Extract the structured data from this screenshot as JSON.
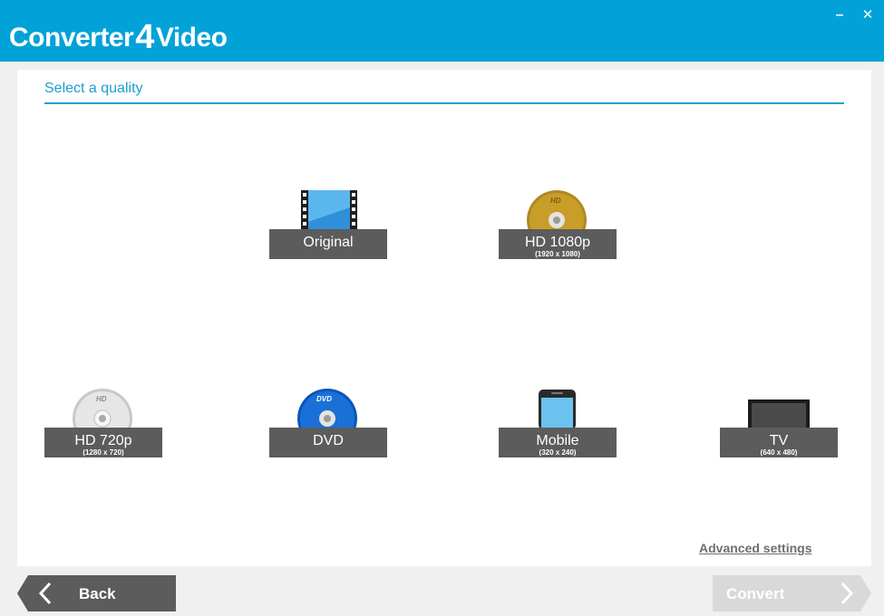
{
  "window": {
    "title_prefix": "Converter",
    "title_number": "4",
    "title_suffix": "Video",
    "minimize_glyph": "–",
    "close_glyph": "✕"
  },
  "section": {
    "title": "Select a quality"
  },
  "qualities": [
    {
      "label": "Original",
      "resolution": "",
      "icon": "film-icon"
    },
    {
      "label": "HD 1080p",
      "resolution": "(1920 x 1080)",
      "icon": "hd-gold-disc-icon"
    },
    {
      "label": "HD 720p",
      "resolution": "(1280 x 720)",
      "icon": "hd-silver-disc-icon"
    },
    {
      "label": "DVD",
      "resolution": "",
      "icon": "dvd-disc-icon"
    },
    {
      "label": "Mobile",
      "resolution": "(320 x 240)",
      "icon": "smartphone-icon"
    },
    {
      "label": "TV",
      "resolution": "(640 x 480)",
      "icon": "tv-icon"
    }
  ],
  "advanced_settings": "Advanced settings",
  "footer": {
    "back_label": "Back",
    "convert_label": "Convert"
  },
  "colors": {
    "accent": "#00a2d8",
    "label_bg": "#5c5c5c",
    "back_bg": "#5c5c5c",
    "convert_disabled_bg": "#d9d9d9"
  }
}
